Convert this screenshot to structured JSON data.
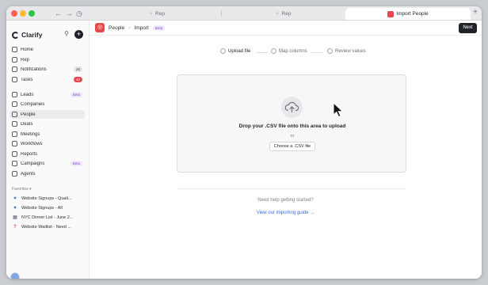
{
  "titlebar": {
    "tabs": [
      {
        "label": "Rep",
        "active": false
      },
      {
        "label": "Rep",
        "active": false
      },
      {
        "label": "Import People",
        "active": true
      }
    ],
    "new_tab": "+"
  },
  "sidebar": {
    "app_name": "Clarify",
    "nav": [
      {
        "label": "Home",
        "icon": "home-icon"
      },
      {
        "label": "Rep",
        "icon": "rep-icon"
      },
      {
        "label": "Notifications",
        "icon": "bell-icon",
        "count": "26"
      },
      {
        "label": "Tasks",
        "icon": "check-icon",
        "count": "42"
      },
      {
        "label": "Leads",
        "icon": "leads-icon",
        "badge": "Beta"
      },
      {
        "label": "Companies",
        "icon": "building-icon"
      },
      {
        "label": "People",
        "icon": "person-icon",
        "active": true
      },
      {
        "label": "Deals",
        "icon": "deals-icon"
      },
      {
        "label": "Meetings",
        "icon": "calendar-icon"
      },
      {
        "label": "Workflows",
        "icon": "workflow-icon"
      },
      {
        "label": "Reports",
        "icon": "chart-icon"
      },
      {
        "label": "Campaigns",
        "icon": "megaphone-icon",
        "badge": "Beta"
      },
      {
        "label": "Agents",
        "icon": "agent-icon"
      }
    ],
    "favorites_label": "Favorites",
    "favorites": [
      {
        "label": "Website Signups - Quali...",
        "icon": "blue-heart-icon"
      },
      {
        "label": "Website Signups - All",
        "icon": "blue-heart-icon"
      },
      {
        "label": "NYC Dinner List - June 2...",
        "icon": "cityscape-icon"
      },
      {
        "label": "Website Waitlist - Need ...",
        "icon": "question-icon"
      }
    ]
  },
  "header": {
    "breadcrumb": [
      "People",
      "Import"
    ],
    "beta_badge": "Beta",
    "next_label": "Next"
  },
  "steps": [
    {
      "label": "Upload file",
      "current": true
    },
    {
      "label": "Map columns",
      "current": false
    },
    {
      "label": "Review values",
      "current": false
    }
  ],
  "upload": {
    "drop_text": "Drop your .CSV file onto this area to upload",
    "or_text": "or",
    "choose_label": "Choose a .CSV file"
  },
  "help": {
    "question": "Need help getting started?",
    "link": "View our importing guide →"
  },
  "colors": {
    "accent": "#e5484d",
    "link": "#3d6fd9",
    "beta": "#8a4dd6",
    "dark": "#1f2328"
  }
}
